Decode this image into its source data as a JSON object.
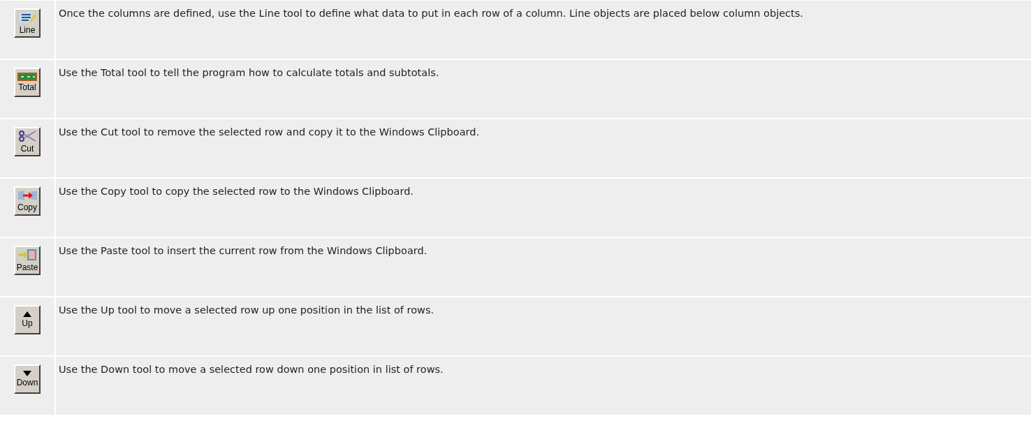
{
  "rows": [
    {
      "kind": "line",
      "label": "Line",
      "description": "Once the columns are defined, use the Line tool to define what data to put in each row of a column. Line objects are placed below column objects."
    },
    {
      "kind": "total",
      "label": "Total",
      "description": "Use the Total tool to tell the program how to calculate totals and subtotals."
    },
    {
      "kind": "cut",
      "label": "Cut",
      "description": "Use the Cut tool to remove the selected row and copy it to the Windows Clipboard."
    },
    {
      "kind": "copy",
      "label": "Copy",
      "description": "Use the Copy tool to copy the selected row to the Windows Clipboard."
    },
    {
      "kind": "paste",
      "label": "Paste",
      "description": "Use the Paste tool to insert the current row from the Windows Clipboard."
    },
    {
      "kind": "up",
      "label": "Up",
      "description": "Use the Up tool to move a selected row up one position in the list of rows."
    },
    {
      "kind": "down",
      "label": "Down",
      "description": "Use the Down tool to move a selected row down one position in list of rows."
    }
  ]
}
